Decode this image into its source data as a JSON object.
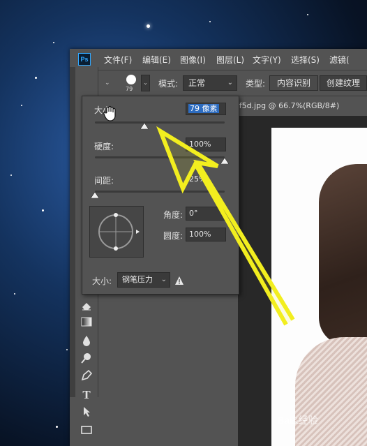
{
  "app": {
    "logo": "Ps"
  },
  "menubar": {
    "items": [
      "文件(F)",
      "编辑(E)",
      "图像(I)",
      "图层(L)",
      "文字(Y)",
      "选择(S)",
      "滤镜("
    ]
  },
  "options": {
    "brush_size": "79",
    "mode_label": "模式:",
    "mode_value": "正常",
    "type_label": "类型:",
    "type_buttons": [
      "内容识别",
      "创建纹理"
    ]
  },
  "document": {
    "tab_title": "ff5d.jpg @ 66.7%(RGB/8#)"
  },
  "brush_popup": {
    "size_label": "大小:",
    "size_value": "79 像素",
    "size_fraction": 0.38,
    "hardness_label": "硬度:",
    "hardness_value": "100%",
    "hardness_fraction": 1.0,
    "spacing_label": "间距:",
    "spacing_value": "25%",
    "spacing_fraction": 0.0,
    "angle_label": "角度:",
    "angle_value": "0°",
    "roundness_label": "圆度:",
    "roundness_value": "100%",
    "pen_label": "大小:",
    "pen_value": "钢笔压力",
    "warning_icon": "warning-icon"
  },
  "tools": [
    "eraser-icon",
    "gradient-icon",
    "blur-icon",
    "dodge-icon",
    "pen-icon",
    "type-icon",
    "path-select-icon",
    "rectangle-icon"
  ],
  "watermark": "Bai&经验",
  "colors": {
    "accent": "#31a8ff",
    "arrow": "#f2ee1f",
    "panel": "#535353"
  }
}
